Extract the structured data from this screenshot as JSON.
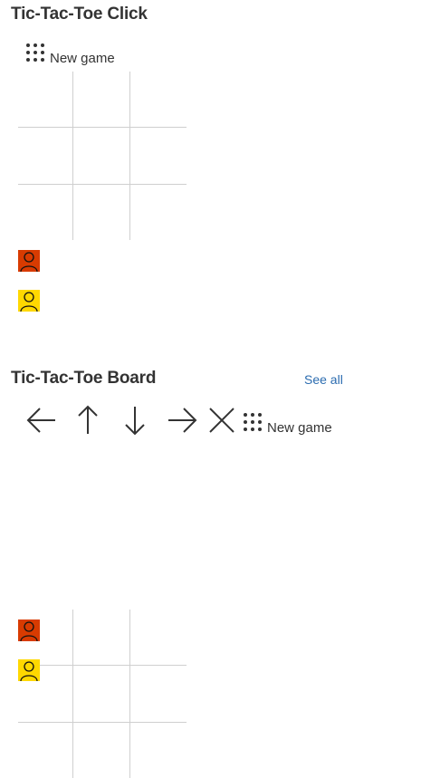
{
  "click_section": {
    "title": "Tic-Tac-Toe Click",
    "new_game_label": "New game",
    "icons": [
      "grid-dots-icon"
    ],
    "players": [
      {
        "icon": "person-icon",
        "color": "#d83b01"
      },
      {
        "icon": "person-icon",
        "color": "#ffd800"
      }
    ]
  },
  "board_section": {
    "title": "Tic-Tac-Toe Board",
    "see_all_label": "See all",
    "new_game_label": "New game",
    "icons": [
      "arrow-left-icon",
      "arrow-up-icon",
      "arrow-down-icon",
      "arrow-right-icon",
      "close-icon",
      "grid-dots-icon"
    ],
    "players": [
      {
        "icon": "person-icon",
        "color": "#d83b01"
      },
      {
        "icon": "person-icon",
        "color": "#ffd800"
      }
    ]
  },
  "colors": {
    "link": "#2b6cb0",
    "grid_line": "#cfcfcf",
    "text": "#333333"
  }
}
